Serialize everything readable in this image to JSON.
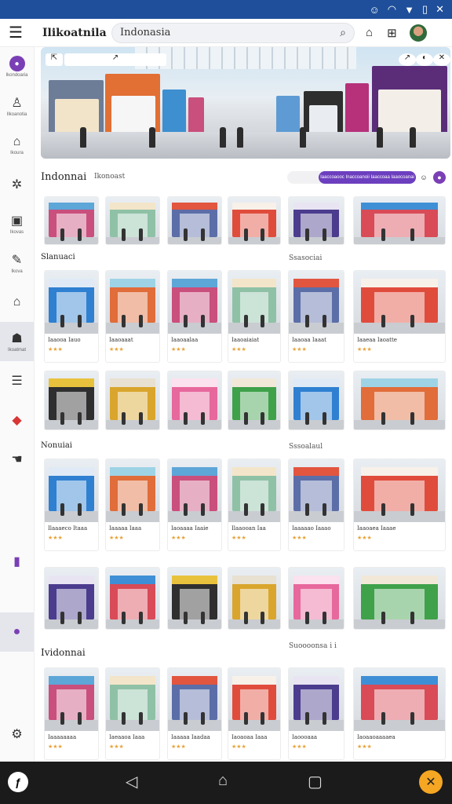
{
  "statusbar": {
    "icons": [
      "app-icon",
      "wifi-icon",
      "signal-icon",
      "wifi-off-icon",
      "close-icon"
    ]
  },
  "topbar": {
    "title": "Ilikoatnila",
    "search_value": "Indonasia",
    "search_icon": "search-icon",
    "icons": [
      "home-icon",
      "grid-icon"
    ]
  },
  "sidebar": {
    "items": [
      {
        "icon": "logo-icon",
        "label": "Ikondoaria"
      },
      {
        "icon": "person-icon",
        "label": "Ilkoanotia"
      },
      {
        "icon": "cap-icon",
        "label": "Ikoura"
      },
      {
        "icon": "settings-icon",
        "label": ""
      },
      {
        "icon": "book-icon",
        "label": "Ikovas"
      },
      {
        "icon": "pen-icon",
        "label": "Ikova"
      },
      {
        "icon": "house-icon",
        "label": ""
      },
      {
        "icon": "group-icon",
        "label": "Ikoatmat"
      },
      {
        "icon": "list-icon",
        "label": ""
      },
      {
        "icon": "red-badge-icon",
        "label": ""
      },
      {
        "icon": "hand-icon",
        "label": ""
      },
      {
        "icon": "purple-doc-icon",
        "label": ""
      },
      {
        "icon": "chat-icon",
        "label": ""
      },
      {
        "icon": "gear-icon",
        "label": ""
      }
    ]
  },
  "sections": {
    "s1_title": "Indonnai",
    "s1_sub": "Ikonoast",
    "s1_filter": "Iaaccoaooc Inaccoanoii Iaaccoaa Iaaocoanai",
    "s2_left": "Slanuaci",
    "s2_right": "Ssasociai",
    "s3_left": "Nonuiai",
    "s3_right": "Sssoalaul",
    "s4_left": "Ividonnai",
    "s4_right": "Suoooonsa i i"
  },
  "cards": {
    "row2": [
      "Iaaooa Iauo",
      "Iaaoaaat",
      "Iaaoaalaa",
      "Iaaoaiaiat",
      "Iaaoaa Iaaat",
      "Iaaeaa Iaoatte"
    ],
    "row4": [
      "Ilaaaeco Itaaa",
      "Iaaaaa Iaaa",
      "Iaoaaaa Iaaie",
      "Ilaaooan Iaa",
      "Iaaaaao Iaaao",
      "Iaaoaea Iaaae"
    ],
    "row6": [
      "Iaaaaaaaa",
      "Iaeaaoa Iaaa",
      "Iaaaaa Iaadaa",
      "Iaoaoaa Iaaa",
      "Iaoooaaa",
      "Iaoaaoaaaaea"
    ]
  },
  "colors": {
    "accent": "#6c3fbf",
    "statusbar": "#1f4f9a",
    "star": "#e8a33a"
  }
}
